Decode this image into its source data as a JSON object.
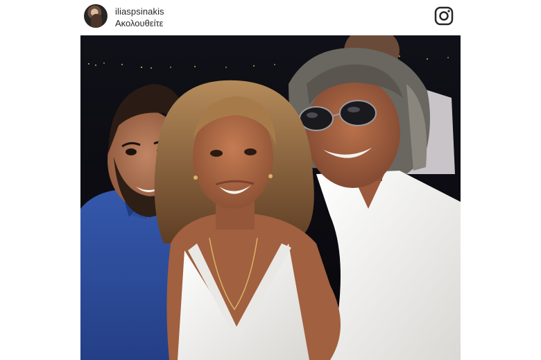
{
  "post": {
    "username": "iliaspsinakis",
    "follow_label": "Ακολουθείτε"
  },
  "icons": {
    "avatar": "profile-avatar",
    "brand": "instagram-icon"
  },
  "photo": {
    "subject": "three-people-night-portrait"
  },
  "colors": {
    "text": "#262626",
    "photo_bg": "#0b0b10",
    "shirt_blue": "#2f4fa2",
    "dress_white": "#f2f1ee",
    "skin": "#a96a49"
  }
}
